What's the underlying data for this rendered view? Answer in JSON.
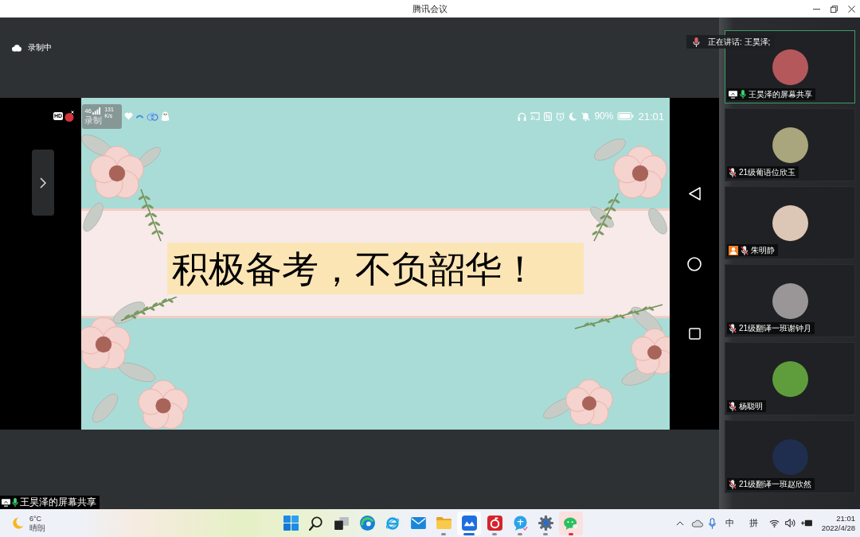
{
  "window": {
    "title": "腾讯会议"
  },
  "recording_status": "录制中",
  "phone_status_bar": {
    "hd": "HD",
    "network": "46",
    "speed": "131",
    "speed_unit": "K/s",
    "recording": "录制",
    "battery": "90%",
    "time": "21:01"
  },
  "slide": {
    "headline": "积极备考，不负韶华！"
  },
  "speaker_indicator": {
    "label": "正在讲话: 王昊泽;"
  },
  "participants": [
    {
      "name": "王昊泽的屏幕共享",
      "muted": false,
      "sharing": true,
      "highlighted": true,
      "person_badge": false,
      "color": "#b5585c"
    },
    {
      "name": "21级葡语位欣玉",
      "muted": true,
      "sharing": false,
      "highlighted": false,
      "person_badge": false,
      "color": "#a9a57c"
    },
    {
      "name": "朱明静",
      "muted": true,
      "sharing": false,
      "highlighted": false,
      "person_badge": true,
      "color": "#dcc6b6"
    },
    {
      "name": "21级翻译一班谢钟月",
      "muted": true,
      "sharing": false,
      "highlighted": false,
      "person_badge": false,
      "color": "#9a9597"
    },
    {
      "name": "杨聪明",
      "muted": true,
      "sharing": false,
      "highlighted": false,
      "person_badge": false,
      "color": "#5f9d3c"
    },
    {
      "name": "21级翻译一班赵欣然",
      "muted": true,
      "sharing": false,
      "highlighted": false,
      "person_badge": false,
      "color": "#1f2d4f"
    }
  ],
  "share_label": {
    "name": "王昊泽的屏幕共享",
    "sharing": true,
    "muted": false
  },
  "taskbar": {
    "weather": {
      "temperature": "6°C",
      "condition": "晴朗"
    },
    "apps": [
      {
        "kind": "start",
        "running": false,
        "selected": false,
        "attention": false
      },
      {
        "kind": "search",
        "running": false,
        "selected": false,
        "attention": false
      },
      {
        "kind": "task_view",
        "running": false,
        "selected": false,
        "attention": false
      },
      {
        "kind": "swirl_browser",
        "running": false,
        "selected": false,
        "attention": false
      },
      {
        "kind": "ring_browser",
        "running": false,
        "selected": false,
        "attention": false
      },
      {
        "kind": "mail",
        "running": false,
        "selected": false,
        "attention": false
      },
      {
        "kind": "files",
        "running": true,
        "selected": false,
        "attention": false
      },
      {
        "kind": "meeting",
        "running": true,
        "selected": true,
        "attention": false
      },
      {
        "kind": "music",
        "running": true,
        "selected": false,
        "attention": false
      },
      {
        "kind": "translator",
        "running": true,
        "selected": false,
        "attention": false
      },
      {
        "kind": "settings",
        "running": true,
        "selected": false,
        "attention": false
      },
      {
        "kind": "chat",
        "running": true,
        "selected": false,
        "attention": true
      }
    ],
    "tray": {
      "input_mode": "中",
      "input_method": "拼",
      "time": "21:01",
      "date": "2022/4/28"
    }
  }
}
